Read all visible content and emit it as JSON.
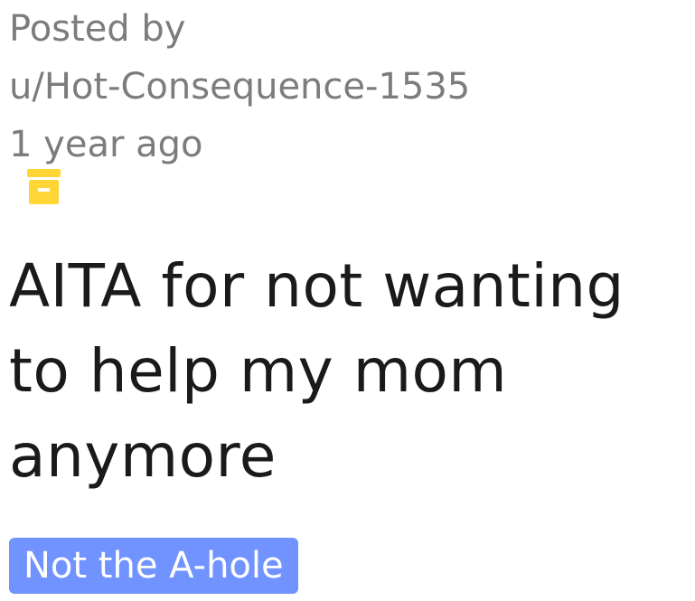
{
  "post": {
    "posted_by_label": "Posted by",
    "author": "u/Hot-Consequence-1535",
    "time_ago": "1 year ago",
    "status_icon": "archive-icon",
    "title": "AITA for not wanting to help my mom anymore",
    "flair": "Not the A-hole"
  },
  "colors": {
    "meta_text": "#7c7c7c",
    "title_text": "#1a1a1b",
    "archive_icon": "#ffd635",
    "flair_bg": "#7193ff",
    "flair_text": "#ffffff"
  }
}
